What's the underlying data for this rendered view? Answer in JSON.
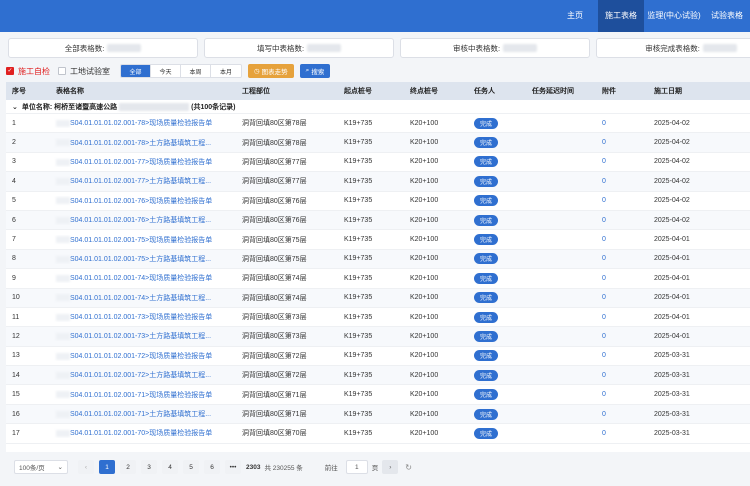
{
  "nav": {
    "items": [
      {
        "label": "主页",
        "active": false,
        "width": 46
      },
      {
        "label": "施工表格",
        "active": true,
        "width": 46
      },
      {
        "label": "监理(中心试验)",
        "active": false,
        "width": 60
      },
      {
        "label": "试验表格",
        "active": false,
        "width": 46
      }
    ]
  },
  "stats": {
    "all_label": "全部表格数:",
    "filling_label": "填写中表格数:",
    "reviewing_label": "审核中表格数:",
    "done_label": "审核完成表格数:"
  },
  "filters": {
    "self_check_label": "施工自检",
    "lab_label": "工地试验室",
    "segments": [
      "全部",
      "今天",
      "本周",
      "本月"
    ],
    "trend_button": "图表走势",
    "search_button": "搜索"
  },
  "table": {
    "headers": [
      "序号",
      "表格名称",
      "工程部位",
      "起点桩号",
      "终点桩号",
      "任务人",
      "任务延迟时间",
      "附件",
      "施工日期"
    ],
    "group_prefix": "单位名称: 柯桥至诸暨高速公路",
    "group_suffix": "(共100条记录)",
    "rows": [
      {
        "no": "1",
        "name": "S04.01.01.01.02.001-78>现场质量检验报告单",
        "part": "洞背回填80区第78层",
        "start": "K19+735",
        "end": "K20+100",
        "status": "完成",
        "attach": "0",
        "date": "2025-04-02"
      },
      {
        "no": "2",
        "name": "S04.01.01.01.02.001-78>土方路基填筑工程...",
        "part": "洞背回填80区第78层",
        "start": "K19+735",
        "end": "K20+100",
        "status": "完成",
        "attach": "0",
        "date": "2025-04-02"
      },
      {
        "no": "3",
        "name": "S04.01.01.01.02.001-77>现场质量检验报告单",
        "part": "洞背回填80区第77层",
        "start": "K19+735",
        "end": "K20+100",
        "status": "完成",
        "attach": "0",
        "date": "2025-04-02"
      },
      {
        "no": "4",
        "name": "S04.01.01.01.02.001-77>土方路基填筑工程...",
        "part": "洞背回填80区第77层",
        "start": "K19+735",
        "end": "K20+100",
        "status": "完成",
        "attach": "0",
        "date": "2025-04-02"
      },
      {
        "no": "5",
        "name": "S04.01.01.01.02.001-76>现场质量检验报告单",
        "part": "洞背回填80区第76层",
        "start": "K19+735",
        "end": "K20+100",
        "status": "完成",
        "attach": "0",
        "date": "2025-04-02"
      },
      {
        "no": "6",
        "name": "S04.01.01.01.02.001-76>土方路基填筑工程...",
        "part": "洞背回填80区第76层",
        "start": "K19+735",
        "end": "K20+100",
        "status": "完成",
        "attach": "0",
        "date": "2025-04-02"
      },
      {
        "no": "7",
        "name": "S04.01.01.01.02.001-75>现场质量检验报告单",
        "part": "洞背回填80区第75层",
        "start": "K19+735",
        "end": "K20+100",
        "status": "完成",
        "attach": "0",
        "date": "2025-04-01"
      },
      {
        "no": "8",
        "name": "S04.01.01.01.02.001-75>土方路基填筑工程...",
        "part": "洞背回填80区第75层",
        "start": "K19+735",
        "end": "K20+100",
        "status": "完成",
        "attach": "0",
        "date": "2025-04-01"
      },
      {
        "no": "9",
        "name": "S04.01.01.01.02.001-74>现场质量检验报告单",
        "part": "洞背回填80区第74层",
        "start": "K19+735",
        "end": "K20+100",
        "status": "完成",
        "attach": "0",
        "date": "2025-04-01"
      },
      {
        "no": "10",
        "name": "S04.01.01.01.02.001-74>土方路基填筑工程...",
        "part": "洞背回填80区第74层",
        "start": "K19+735",
        "end": "K20+100",
        "status": "完成",
        "attach": "0",
        "date": "2025-04-01"
      },
      {
        "no": "11",
        "name": "S04.01.01.01.02.001-73>现场质量检验报告单",
        "part": "洞背回填80区第73层",
        "start": "K19+735",
        "end": "K20+100",
        "status": "完成",
        "attach": "0",
        "date": "2025-04-01"
      },
      {
        "no": "12",
        "name": "S04.01.01.01.02.001-73>土方路基填筑工程...",
        "part": "洞背回填80区第73层",
        "start": "K19+735",
        "end": "K20+100",
        "status": "完成",
        "attach": "0",
        "date": "2025-04-01"
      },
      {
        "no": "13",
        "name": "S04.01.01.01.02.001-72>现场质量检验报告单",
        "part": "洞背回填80区第72层",
        "start": "K19+735",
        "end": "K20+100",
        "status": "完成",
        "attach": "0",
        "date": "2025-03-31"
      },
      {
        "no": "14",
        "name": "S04.01.01.01.02.001-72>土方路基填筑工程...",
        "part": "洞背回填80区第72层",
        "start": "K19+735",
        "end": "K20+100",
        "status": "完成",
        "attach": "0",
        "date": "2025-03-31"
      },
      {
        "no": "15",
        "name": "S04.01.01.01.02.001-71>现场质量检验报告单",
        "part": "洞背回填80区第71层",
        "start": "K19+735",
        "end": "K20+100",
        "status": "完成",
        "attach": "0",
        "date": "2025-03-31"
      },
      {
        "no": "16",
        "name": "S04.01.01.01.02.001-71>土方路基填筑工程...",
        "part": "洞背回填80区第71层",
        "start": "K19+735",
        "end": "K20+100",
        "status": "完成",
        "attach": "0",
        "date": "2025-03-31"
      },
      {
        "no": "17",
        "name": "S04.01.01.01.02.001-70>现场质量检验报告单",
        "part": "洞背回填80区第70层",
        "start": "K19+735",
        "end": "K20+100",
        "status": "完成",
        "attach": "0",
        "date": "2025-03-31"
      }
    ]
  },
  "pager": {
    "page_size": "100条/页",
    "pages": [
      "1",
      "2",
      "3",
      "4",
      "5",
      "6"
    ],
    "ellipsis": "•••",
    "last_page": "2303",
    "total": "共 230255 条",
    "goto_label": "前往",
    "goto_value": "1",
    "page_unit": "页"
  },
  "colors": {
    "primary": "#2f6fd0",
    "nav_bg": "#2f6fd0",
    "nav_active": "#1e4f9c",
    "red": "#e02020",
    "orange": "#e6a23c"
  }
}
